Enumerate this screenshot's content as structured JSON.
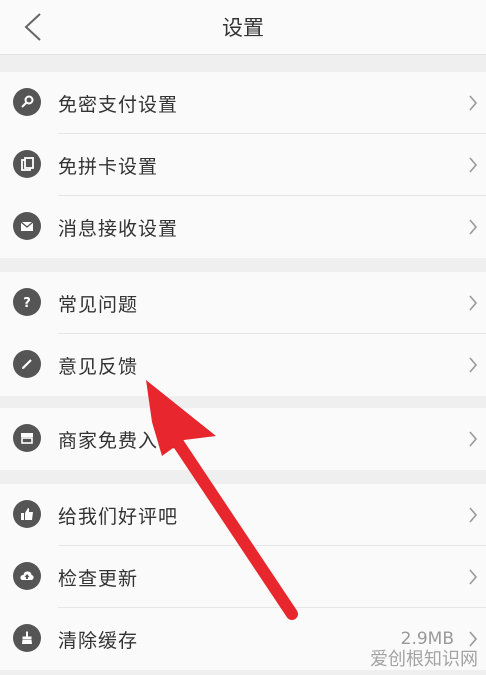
{
  "header": {
    "title": "设置"
  },
  "groups": [
    [
      {
        "label": "免密支付设置"
      },
      {
        "label": "免拼卡设置"
      },
      {
        "label": "消息接收设置"
      }
    ],
    [
      {
        "label": "常见问题"
      },
      {
        "label": "意见反馈"
      }
    ],
    [
      {
        "label": "商家免费入驻"
      }
    ],
    [
      {
        "label": "给我们好评吧"
      },
      {
        "label": "检查更新"
      },
      {
        "label": "清除缓存",
        "value": "2.9MB"
      }
    ]
  ],
  "watermark": "爱创根知识网",
  "colors": {
    "accent_arrow": "#e8262d",
    "icon_bg": "#555555"
  }
}
